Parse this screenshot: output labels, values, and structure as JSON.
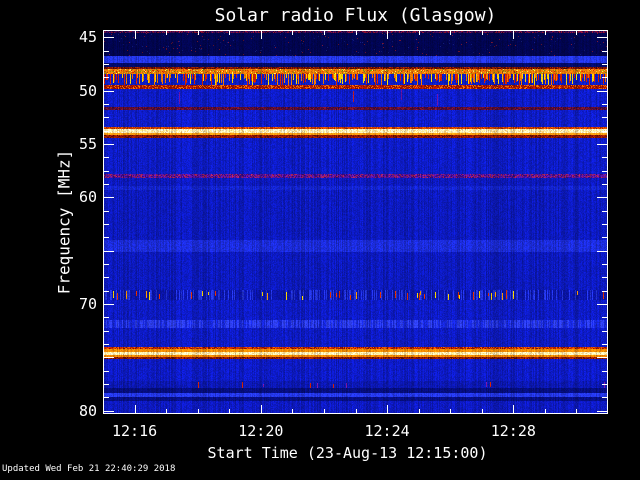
{
  "title": "Solar radio Flux (Glasgow)",
  "footer": {
    "updated_text": "Updated Wed Feb 21 22:40:29 2018"
  },
  "palette": {
    "background": "#000000",
    "axis": "#ffffff",
    "base_blue": "#0d1bc2",
    "dark_navy": "#01044e",
    "bright_blue": "#2335e6",
    "orange": "#f08800",
    "cream": "#ffeeb4",
    "red": "#c22a02",
    "dark_red": "#8c1202",
    "purple": "#5a12a6"
  },
  "chart_data": {
    "type": "heatmap",
    "subtype": "radio-spectrogram",
    "title": "Solar radio Flux (Glasgow)",
    "xlabel": "Start Time (23-Aug-13 12:15:00)",
    "ylabel": "Frequency [MHz]",
    "grid": false,
    "x_axis": {
      "start_time": "12:15:00",
      "date": "23-Aug-13",
      "minutes_span": 16,
      "tick_every_minutes": 1,
      "major_minutes": [
        1,
        5,
        9,
        13
      ],
      "labels": [
        "12:16",
        "12:20",
        "12:24",
        "12:28"
      ]
    },
    "y_axis": {
      "min": 44.3,
      "max": 80.3,
      "unit": "MHz",
      "direction": "increasing-downward",
      "major_step": 5,
      "minor_step": 1.25,
      "labeled_values": [
        45,
        50,
        55,
        60,
        70,
        80
      ]
    },
    "bands": [
      {
        "f0": 44.3,
        "f1": 44.58,
        "style": "mottle",
        "base": "#3c0a55",
        "alt": [
          "#8a1030",
          "#1a0640"
        ]
      },
      {
        "f0": 44.58,
        "f1": 46.74,
        "style": "speckle",
        "base": "#01044e",
        "alt": [
          "#111a70",
          "#6a1430"
        ],
        "speckle_density": 0.02
      },
      {
        "f0": 46.74,
        "f1": 47.39,
        "style": "flat",
        "base": "#2335e6"
      },
      {
        "f0": 47.39,
        "f1": 47.77,
        "style": "flat",
        "base": "#020a68"
      },
      {
        "f0": 47.77,
        "f1": 47.96,
        "style": "mottle",
        "base": "#7c1202",
        "alt": [
          "#a82400",
          "#4c0a02"
        ]
      },
      {
        "f0": 47.96,
        "f1": 48.43,
        "style": "speckle",
        "base": "#e87a06",
        "alt": [
          "#ffd84a",
          "#7a9410",
          "#cc3000"
        ],
        "speckle_density": 0.22
      },
      {
        "f0": 48.43,
        "f1": 49.46,
        "style": "flat",
        "base": "#0d1cc0",
        "streaks": {
          "mode": "drip",
          "density": 0.5,
          "colors": [
            "#d42300",
            "#f07800",
            "#ffd300"
          ]
        }
      },
      {
        "f0": 49.46,
        "f1": 49.83,
        "style": "mottle",
        "base": "#b41a02",
        "alt": [
          "#e86c00",
          "#8c0e00"
        ]
      },
      {
        "f0": 49.83,
        "f1": 51.52,
        "style": "flat",
        "base": "#0d1bc4",
        "streaks": {
          "mode": "dash",
          "density": 0.006,
          "colors": [
            "#c02020",
            "#6a14a0"
          ]
        }
      },
      {
        "f0": 51.52,
        "f1": 51.8,
        "style": "mottle",
        "base": "#5a0c2e",
        "alt": [
          "#7a1430",
          "#3a0840"
        ]
      },
      {
        "f0": 51.8,
        "f1": 53.39,
        "style": "flat",
        "base": "#0e1cc6"
      },
      {
        "f0": 53.39,
        "f1": 53.58,
        "style": "mottle",
        "base": "#c83c02",
        "alt": [
          "#a82a00",
          "#e85c00"
        ]
      },
      {
        "f0": 53.58,
        "f1": 53.96,
        "style": "mottle",
        "base": "#ffeeb4",
        "alt": [
          "#ffd880",
          "#fff4cc"
        ]
      },
      {
        "f0": 53.96,
        "f1": 54.14,
        "style": "flat",
        "base": "#fb9a12"
      },
      {
        "f0": 54.14,
        "f1": 54.43,
        "style": "mottle",
        "base": "#8c1202",
        "alt": [
          "#a82200",
          "#5c0c02"
        ]
      },
      {
        "f0": 54.43,
        "f1": 57.8,
        "style": "flat",
        "base": "#0d1bc2"
      },
      {
        "f0": 57.8,
        "f1": 58.18,
        "style": "mottle",
        "base": "#5a12a6",
        "alt": [
          "#a02058",
          "#3c0a80"
        ]
      },
      {
        "f0": 58.18,
        "f1": 58.9,
        "style": "flat",
        "base": "#0c19ba"
      },
      {
        "f0": 58.9,
        "f1": 59.3,
        "style": "flat",
        "base": "#1323ca"
      },
      {
        "f0": 59.3,
        "f1": 63.99,
        "style": "flat",
        "base": "#0c19ba"
      },
      {
        "f0": 63.99,
        "f1": 65.11,
        "style": "flat",
        "base": "#1b2bd6"
      },
      {
        "f0": 65.11,
        "f1": 68.68,
        "style": "flat",
        "base": "#0c19ba"
      },
      {
        "f0": 68.68,
        "f1": 69.61,
        "style": "flat",
        "base": "#0a14a6",
        "colstreak": {
          "density": 0.3,
          "color": "#2334dc"
        },
        "streaks": {
          "mode": "dash",
          "density": 0.09,
          "colors": [
            "#e03000",
            "#ff9800",
            "#ffd400"
          ]
        }
      },
      {
        "f0": 69.61,
        "f1": 71.49,
        "style": "flat",
        "base": "#0d1ac0"
      },
      {
        "f0": 71.49,
        "f1": 72.24,
        "style": "flat",
        "base": "#1626d2",
        "colstreak": {
          "density": 0.5,
          "color": "#2c3ce8"
        }
      },
      {
        "f0": 72.24,
        "f1": 74.02,
        "style": "flat",
        "base": "#0d1ac0"
      },
      {
        "f0": 74.02,
        "f1": 74.21,
        "style": "mottle",
        "base": "#c22a02",
        "alt": [
          "#e85c00",
          "#8c1200"
        ]
      },
      {
        "f0": 74.21,
        "f1": 74.49,
        "style": "flat",
        "base": "#f28a02"
      },
      {
        "f0": 74.49,
        "f1": 74.77,
        "style": "mottle",
        "base": "#ffeaac",
        "alt": [
          "#ffdc86",
          "#fff2c8"
        ]
      },
      {
        "f0": 74.77,
        "f1": 74.96,
        "style": "flat",
        "base": "#ef8602"
      },
      {
        "f0": 74.96,
        "f1": 75.15,
        "style": "mottle",
        "base": "#8c1402",
        "alt": [
          "#a82400",
          "#5c0c02"
        ]
      },
      {
        "f0": 75.15,
        "f1": 77.21,
        "style": "flat",
        "base": "#0d1ac2"
      },
      {
        "f0": 77.21,
        "f1": 77.86,
        "style": "flat",
        "base": "#0b17ae",
        "streaks": {
          "mode": "dash",
          "density": 0.03,
          "colors": [
            "#d02400",
            "#8018a8"
          ]
        }
      },
      {
        "f0": 77.86,
        "f1": 78.33,
        "style": "flat",
        "base": "#050d7c"
      },
      {
        "f0": 78.33,
        "f1": 78.71,
        "style": "flat",
        "base": "#2437e8"
      },
      {
        "f0": 78.71,
        "f1": 79.08,
        "style": "flat",
        "base": "#060e82"
      },
      {
        "f0": 79.08,
        "f1": 80.3,
        "style": "flat",
        "base": "#0d19bd"
      }
    ]
  }
}
